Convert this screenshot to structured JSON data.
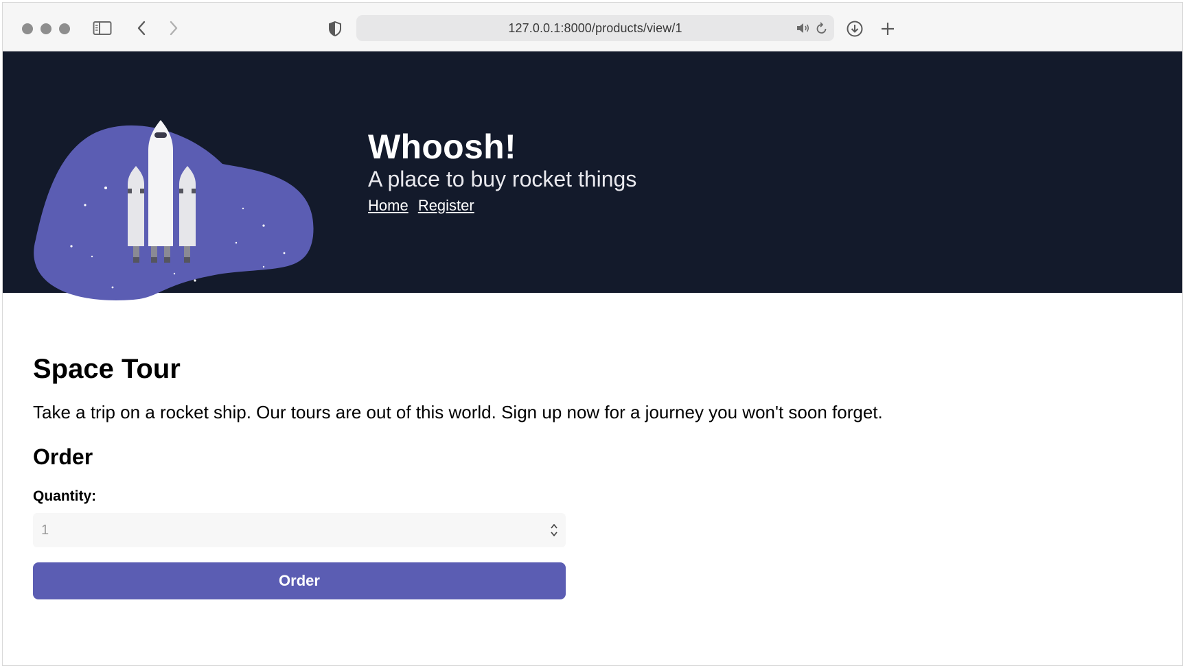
{
  "browser": {
    "url": "127.0.0.1:8000/products/view/1",
    "icons": [
      "sidebar-icon",
      "back-icon",
      "forward-icon",
      "shield-icon",
      "speaker-icon",
      "reload-icon",
      "download-icon",
      "plus-icon"
    ]
  },
  "header": {
    "title": "Whoosh!",
    "tagline": "A place to buy rocket things",
    "nav": {
      "home": "Home",
      "register": "Register"
    },
    "colors": {
      "background": "#131a2b",
      "blob": "#5b5db3"
    }
  },
  "product": {
    "name": "Space Tour",
    "description": "Take a trip on a rocket ship. Our tours are out of this world. Sign up now for a journey you won't soon forget."
  },
  "order": {
    "heading": "Order",
    "quantity_label": "Quantity:",
    "quantity_value": "1",
    "button_label": "Order",
    "accent": "#5b5db3"
  }
}
